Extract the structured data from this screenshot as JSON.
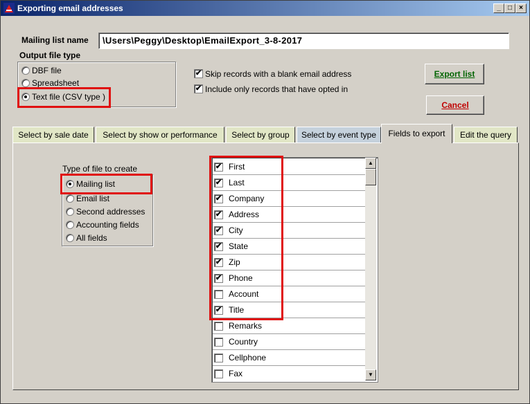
{
  "window": {
    "title": "Exporting email addresses"
  },
  "mailing_list": {
    "label": "Mailing list name",
    "value": "\\Users\\Peggy\\Desktop\\EmailExport_3-8-2017"
  },
  "output_type": {
    "label": "Output file type",
    "options": [
      {
        "label": "DBF file",
        "selected": false
      },
      {
        "label": "Spreadsheet",
        "selected": false
      },
      {
        "label": "Text file (CSV type )",
        "selected": true
      }
    ]
  },
  "options": {
    "skip_blank": {
      "label": "Skip records with a blank email address",
      "checked": true
    },
    "opted_in": {
      "label": "Include only records that have opted in",
      "checked": true
    }
  },
  "buttons": {
    "export": "Export list",
    "cancel": "Cancel"
  },
  "tabs": [
    {
      "label": "Select by sale date",
      "active": false
    },
    {
      "label": "Select by show or performance",
      "active": false
    },
    {
      "label": "Select by group",
      "active": false
    },
    {
      "label": "Select by event type",
      "active": false
    },
    {
      "label": "Fields to export",
      "active": true
    },
    {
      "label": "Edit the query",
      "active": false
    }
  ],
  "file_type": {
    "label": "Type of file to create",
    "options": [
      {
        "label": "Mailing list",
        "selected": true
      },
      {
        "label": "Email list",
        "selected": false
      },
      {
        "label": "Second addresses",
        "selected": false
      },
      {
        "label": "Accounting fields",
        "selected": false
      },
      {
        "label": "All fields",
        "selected": false
      }
    ]
  },
  "fields": [
    {
      "label": "First",
      "checked": true
    },
    {
      "label": "Last",
      "checked": true
    },
    {
      "label": "Company",
      "checked": true
    },
    {
      "label": "Address",
      "checked": true
    },
    {
      "label": "City",
      "checked": true
    },
    {
      "label": "State",
      "checked": true
    },
    {
      "label": "Zip",
      "checked": true
    },
    {
      "label": "Phone",
      "checked": true
    },
    {
      "label": "Account",
      "checked": false
    },
    {
      "label": "Title",
      "checked": true
    },
    {
      "label": "Remarks",
      "checked": false
    },
    {
      "label": "Country",
      "checked": false
    },
    {
      "label": "Cellphone",
      "checked": false
    },
    {
      "label": "Fax",
      "checked": false
    }
  ],
  "colors": {
    "highlight": "#e01010",
    "tab_green": "#e1e6c6",
    "tab_blue": "#c5d1dc",
    "button_text_export": "#006400",
    "button_text_cancel": "#c00000"
  }
}
